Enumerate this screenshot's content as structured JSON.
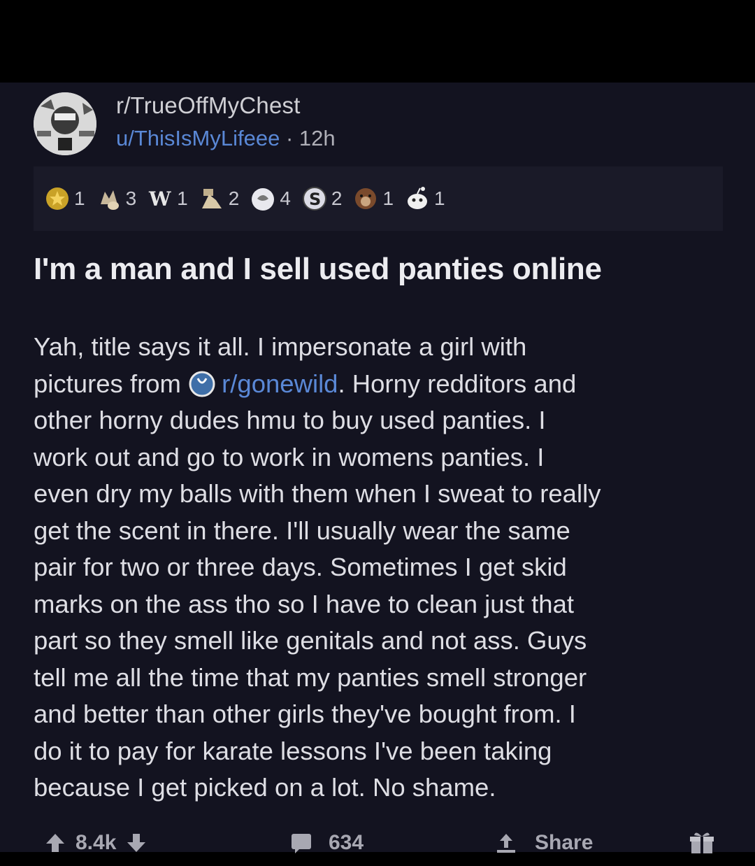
{
  "post": {
    "subreddit": "r/TrueOffMyChest",
    "author": "u/ThisIsMyLifeee",
    "separator": "·",
    "time": "12h",
    "awards": [
      {
        "icon": "gold-award-icon",
        "count": "1"
      },
      {
        "icon": "wholesome-hands-award-icon",
        "count": "3"
      },
      {
        "icon": "w-award-icon",
        "count": "1"
      },
      {
        "icon": "hugz-award-icon",
        "count": "2"
      },
      {
        "icon": "silver-award-icon",
        "count": "4"
      },
      {
        "icon": "s-award-icon",
        "count": "2"
      },
      {
        "icon": "bear-award-icon",
        "count": "1"
      },
      {
        "icon": "snoo-award-icon",
        "count": "1"
      }
    ],
    "title": "I'm a man and I sell used panties online",
    "body_lines": [
      "Yah, title says it all.  I impersonate a girl with",
      "pictures from",
      "other horny dudes hmu to buy used panties.  I",
      "work out and go to work in womens panties.  I",
      "even dry my balls with them when I sweat to really",
      "get the scent in there.  I'll usually wear the same",
      "pair for two or three days.  Sometimes I get skid",
      "marks on the ass tho so I have to clean just that",
      "part so they smell like genitals and not ass.  Guys",
      "tell me all the time that my panties smell stronger",
      "and better than other girls they've bought from.  I",
      "do it to pay for karate lessons I've been taking",
      "because I get picked on a lot.  No shame."
    ],
    "linked_subreddit": "r/gonewild",
    "line2_suffix": ".  Horny redditors and",
    "score": "8.4k",
    "comments": "634",
    "share_label": "Share"
  },
  "colors": {
    "background": "#131320",
    "link": "#5a88d6",
    "text": "#dedee4"
  }
}
